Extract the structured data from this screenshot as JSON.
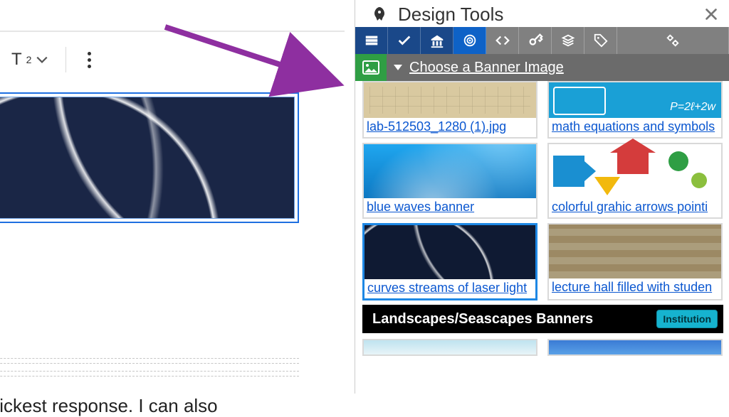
{
  "editor": {
    "superscript_label": "T",
    "body_text": "or quickest response. I can also"
  },
  "panel": {
    "title": "Design Tools",
    "section_label": "Choose a Banner Image",
    "category_label": "Landscapes/Seascapes Banners",
    "pill_label": "Institution",
    "math_eq": "P=2ℓ+2w",
    "thumbs": {
      "lab": "lab-512503_1280 (1).jpg",
      "math": "math equations and symbols",
      "blue": "blue waves banner",
      "arrows": "colorful grahic arrows pointi",
      "laser": "curves streams of laser light",
      "lecture": "lecture hall filled with studen"
    }
  }
}
